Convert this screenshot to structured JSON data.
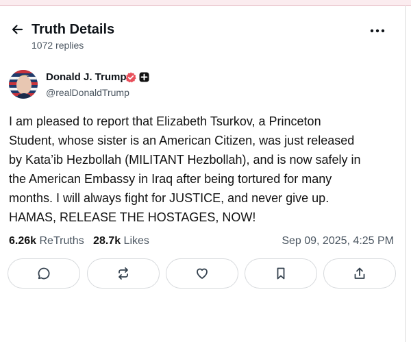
{
  "header": {
    "title": "Truth Details",
    "replies": "1072 replies"
  },
  "icons": {
    "back": "arrow-left-icon",
    "more": "more-horizontal-icon",
    "verified": "verified-badge-icon",
    "plus": "plus-badge-icon",
    "reply": "comment-icon",
    "retruth": "repost-icon",
    "like": "heart-icon",
    "bookmark": "bookmark-icon",
    "share": "share-icon"
  },
  "colors": {
    "verified": "#e8505b",
    "text": "#0f1419",
    "muted": "#4a5560"
  },
  "post": {
    "author_name": "Donald J. Trump",
    "handle": "@realDonaldTrump",
    "body_lines": [
      "I am pleased to report that Elizabeth Tsurkov, a Princeton",
      "Student, whose sister is an American Citizen, was just released",
      "by Kata’ib Hezbollah (MILITANT Hezbollah), and is now safely in",
      "the American Embassy in Iraq after being tortured for many",
      "months. I will always fight for JUSTICE, and never give up.",
      "HAMAS, RELEASE THE HOSTAGES, NOW!"
    ],
    "retruths_count": "6.26k",
    "retruths_label": "ReTruths",
    "likes_count": "28.7k",
    "likes_label": "Likes",
    "timestamp": "Sep 09, 2025, 4:25 PM"
  }
}
